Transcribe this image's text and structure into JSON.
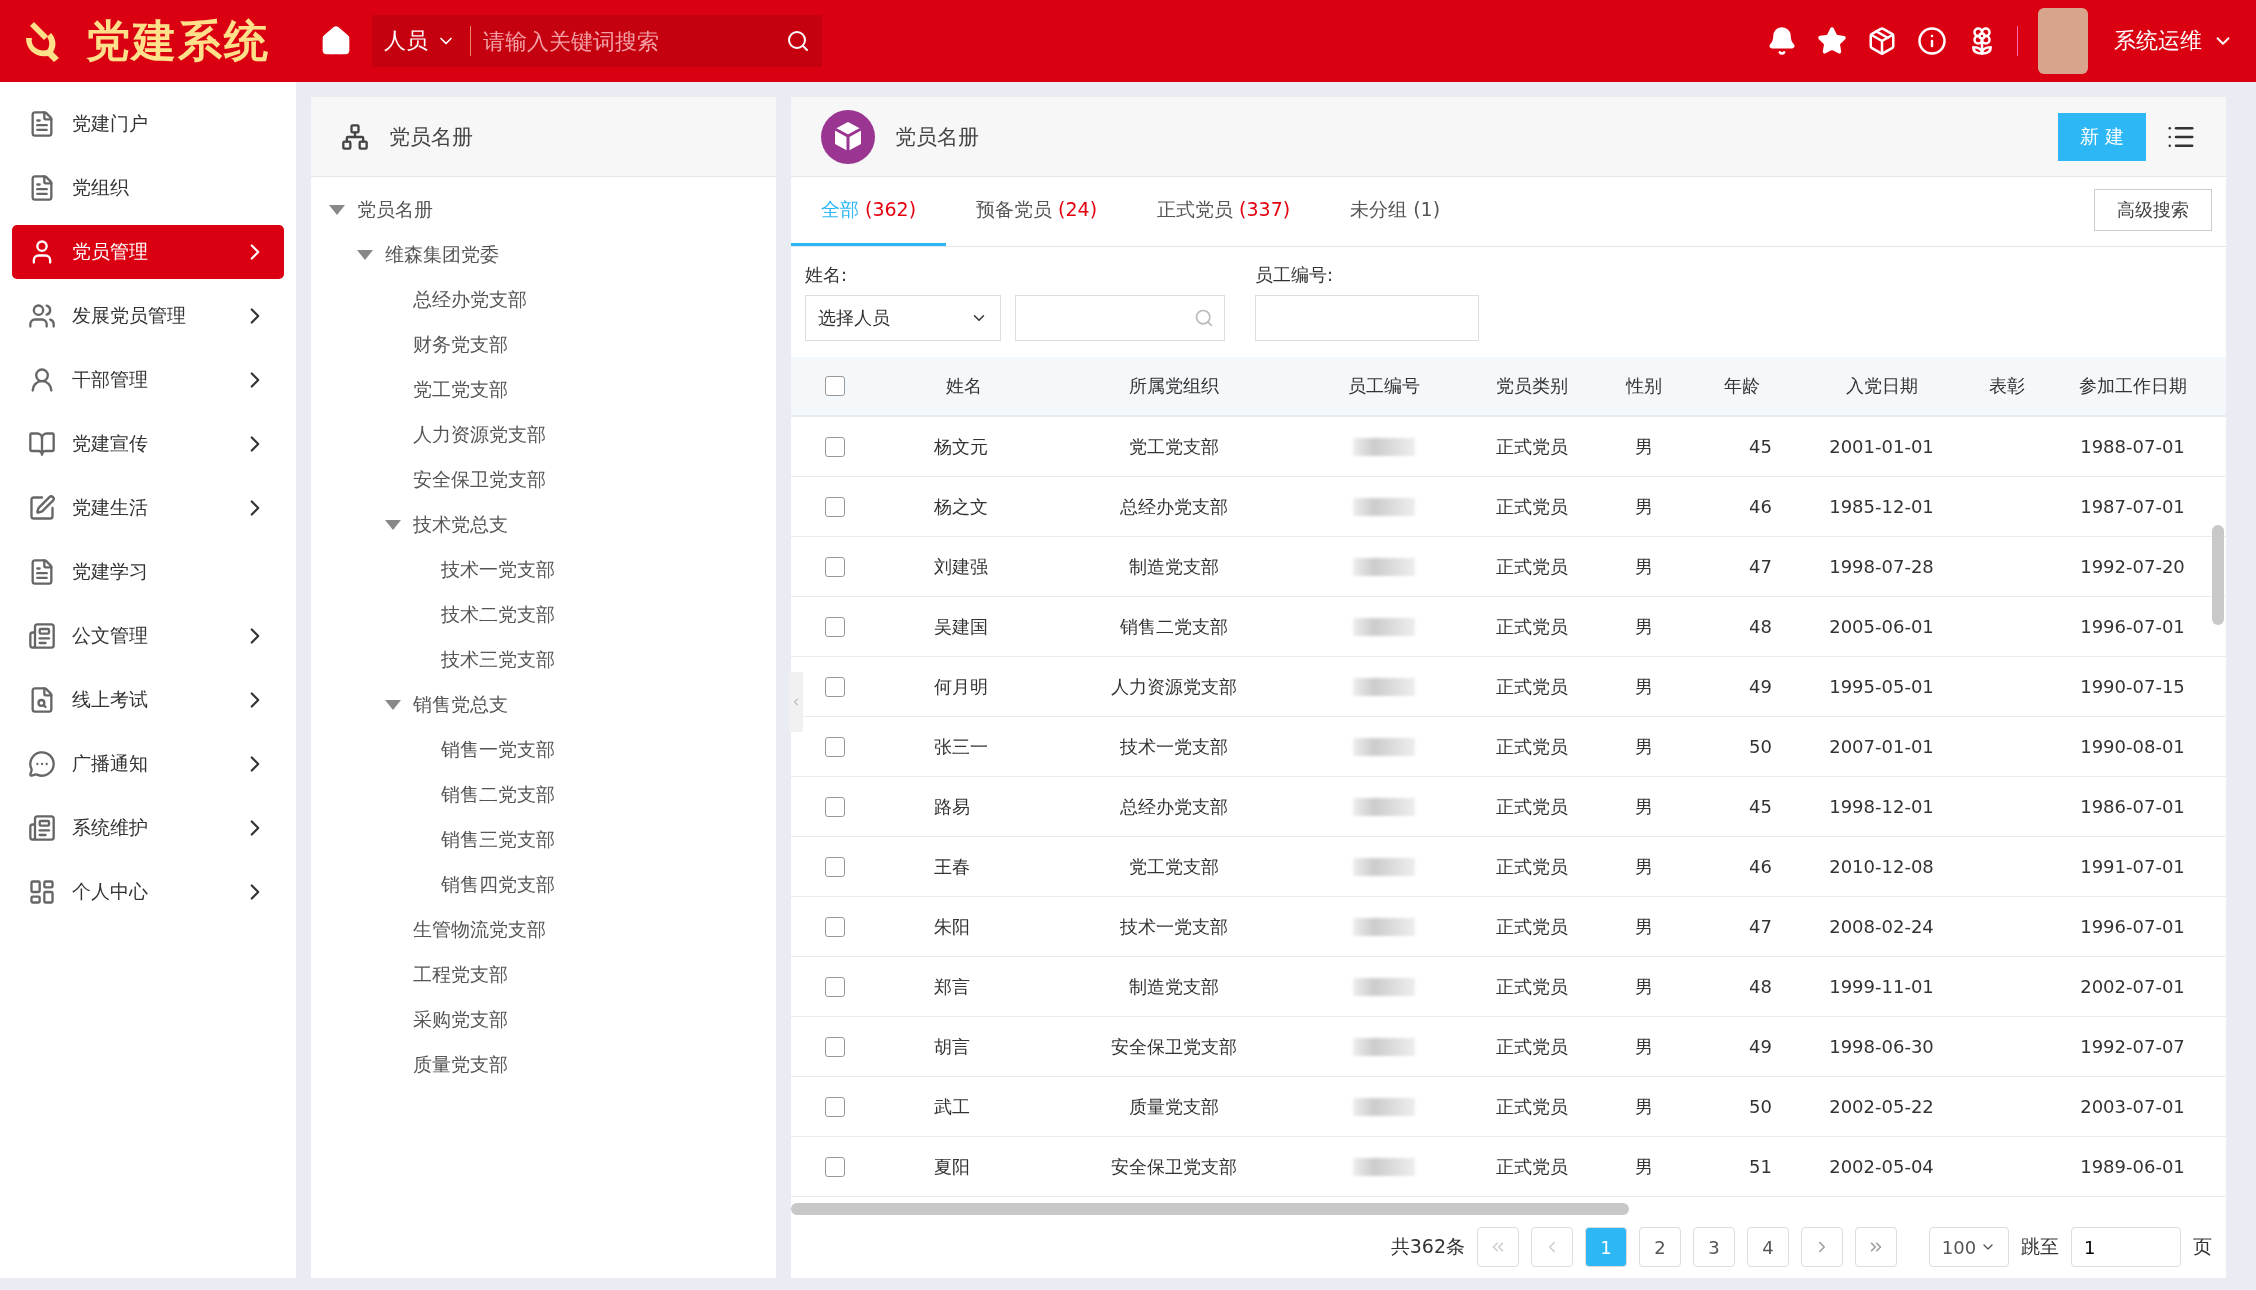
{
  "header": {
    "logo": "党建系统",
    "search_scope": "人员",
    "search_placeholder": "请输入关键词搜索",
    "user": "系统运维"
  },
  "sidebar": {
    "items": [
      {
        "label": "党建门户",
        "expandable": false,
        "selected": false
      },
      {
        "label": "党组织",
        "expandable": false,
        "selected": false
      },
      {
        "label": "党员管理",
        "expandable": true,
        "selected": true
      },
      {
        "label": "发展党员管理",
        "expandable": true,
        "selected": false
      },
      {
        "label": "干部管理",
        "expandable": true,
        "selected": false
      },
      {
        "label": "党建宣传",
        "expandable": true,
        "selected": false
      },
      {
        "label": "党建生活",
        "expandable": true,
        "selected": false
      },
      {
        "label": "党建学习",
        "expandable": false,
        "selected": false
      },
      {
        "label": "公文管理",
        "expandable": true,
        "selected": false
      },
      {
        "label": "线上考试",
        "expandable": true,
        "selected": false
      },
      {
        "label": "广播通知",
        "expandable": true,
        "selected": false
      },
      {
        "label": "系统维护",
        "expandable": true,
        "selected": false
      },
      {
        "label": "个人中心",
        "expandable": true,
        "selected": false
      }
    ]
  },
  "tree_panel": {
    "title": "党员名册",
    "tree": [
      {
        "label": "党员名册",
        "expanded": true,
        "children": [
          {
            "label": "维森集团党委",
            "expanded": true,
            "children": [
              {
                "label": "总经办党支部"
              },
              {
                "label": "财务党支部"
              },
              {
                "label": "党工党支部"
              },
              {
                "label": "人力资源党支部"
              },
              {
                "label": "安全保卫党支部"
              },
              {
                "label": "技术党总支",
                "expanded": true,
                "children": [
                  {
                    "label": "技术一党支部"
                  },
                  {
                    "label": "技术二党支部"
                  },
                  {
                    "label": "技术三党支部"
                  }
                ]
              },
              {
                "label": "销售党总支",
                "expanded": true,
                "children": [
                  {
                    "label": "销售一党支部"
                  },
                  {
                    "label": "销售二党支部"
                  },
                  {
                    "label": "销售三党支部"
                  },
                  {
                    "label": "销售四党支部"
                  }
                ]
              },
              {
                "label": "生管物流党支部"
              },
              {
                "label": "工程党支部"
              },
              {
                "label": "采购党支部"
              },
              {
                "label": "质量党支部"
              }
            ]
          }
        ]
      }
    ]
  },
  "main": {
    "title": "党员名册",
    "new_button": "新 建",
    "tabs": [
      {
        "label": "全部",
        "count": "(362)",
        "count_alert": true,
        "selected": true
      },
      {
        "label": "预备党员",
        "count": "(24)",
        "count_alert": true,
        "selected": false
      },
      {
        "label": "正式党员",
        "count": "(337)",
        "count_alert": true,
        "selected": false
      },
      {
        "label": "未分组",
        "count": "(1)",
        "count_alert": false,
        "selected": false
      }
    ],
    "advanced_search": "高级搜索",
    "filters": {
      "name_label": "姓名:",
      "name_select": "选择人员",
      "id_label": "员工编号:"
    },
    "table": {
      "columns": [
        "姓名",
        "所属党组织",
        "员工编号",
        "党员类别",
        "性别",
        "年龄",
        "入党日期",
        "表彰",
        "参加工作日期"
      ],
      "all_checked": false,
      "rows": [
        {
          "checked": false,
          "name": "杨文元",
          "org": "党工党支部",
          "type": "正式党员",
          "gender": "男",
          "age": "45",
          "join_date": "2001-01-01",
          "work_date": "1988-07-01"
        },
        {
          "checked": false,
          "name": "杨之文",
          "org": "总经办党支部",
          "type": "正式党员",
          "gender": "男",
          "age": "46",
          "join_date": "1985-12-01",
          "work_date": "1987-07-01"
        },
        {
          "checked": false,
          "name": "刘建强",
          "org": "制造党支部",
          "type": "正式党员",
          "gender": "男",
          "age": "47",
          "join_date": "1998-07-28",
          "work_date": "1992-07-20"
        },
        {
          "checked": false,
          "name": "吴建国",
          "org": "销售二党支部",
          "type": "正式党员",
          "gender": "男",
          "age": "48",
          "join_date": "2005-06-01",
          "work_date": "1996-07-01"
        },
        {
          "checked": false,
          "name": "何月明",
          "org": "人力资源党支部",
          "type": "正式党员",
          "gender": "男",
          "age": "49",
          "join_date": "1995-05-01",
          "work_date": "1990-07-15"
        },
        {
          "checked": false,
          "name": "张三一",
          "org": "技术一党支部",
          "type": "正式党员",
          "gender": "男",
          "age": "50",
          "join_date": "2007-01-01",
          "work_date": "1990-08-01"
        },
        {
          "checked": false,
          "name": "路易",
          "org": "总经办党支部",
          "type": "正式党员",
          "gender": "男",
          "age": "45",
          "join_date": "1998-12-01",
          "work_date": "1986-07-01"
        },
        {
          "checked": false,
          "name": "王春",
          "org": "党工党支部",
          "type": "正式党员",
          "gender": "男",
          "age": "46",
          "join_date": "2010-12-08",
          "work_date": "1991-07-01"
        },
        {
          "checked": false,
          "name": "朱阳",
          "org": "技术一党支部",
          "type": "正式党员",
          "gender": "男",
          "age": "47",
          "join_date": "2008-02-24",
          "work_date": "1996-07-01"
        },
        {
          "checked": false,
          "name": "郑言",
          "org": "制造党支部",
          "type": "正式党员",
          "gender": "男",
          "age": "48",
          "join_date": "1999-11-01",
          "work_date": "2002-07-01"
        },
        {
          "checked": false,
          "name": "胡言",
          "org": "安全保卫党支部",
          "type": "正式党员",
          "gender": "男",
          "age": "49",
          "join_date": "1998-06-30",
          "work_date": "1992-07-07"
        },
        {
          "checked": false,
          "name": "武工",
          "org": "质量党支部",
          "type": "正式党员",
          "gender": "男",
          "age": "50",
          "join_date": "2002-05-22",
          "work_date": "2003-07-01"
        },
        {
          "checked": false,
          "name": "夏阳",
          "org": "安全保卫党支部",
          "type": "正式党员",
          "gender": "男",
          "age": "51",
          "join_date": "2002-05-04",
          "work_date": "1989-06-01"
        }
      ]
    },
    "pagination": {
      "total": "共362条",
      "pages": [
        {
          "label": "1",
          "selected": true
        },
        {
          "label": "2",
          "selected": false
        },
        {
          "label": "3",
          "selected": false
        },
        {
          "label": "4",
          "selected": false
        }
      ],
      "page_size": "100",
      "jump_label": "跳至",
      "jump_value": "1",
      "page_suffix": "页"
    }
  }
}
